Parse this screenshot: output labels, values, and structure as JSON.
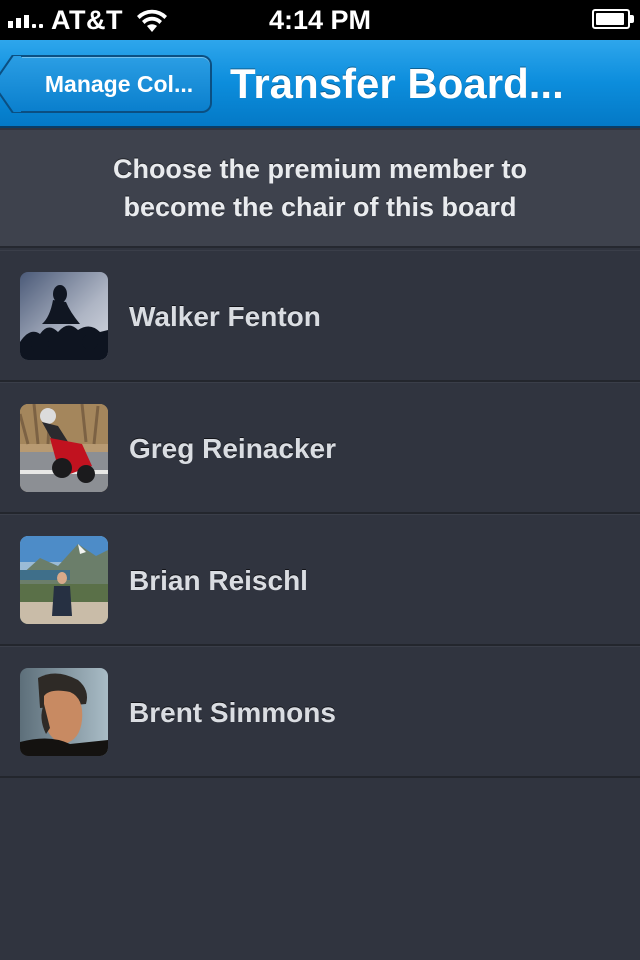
{
  "status_bar": {
    "carrier": "AT&T",
    "time": "4:14 PM",
    "signal_icon": "signal-bars-icon",
    "wifi_icon": "wifi-icon",
    "battery_icon": "battery-icon"
  },
  "nav": {
    "back_label": "Manage Col...",
    "title": "Transfer Board..."
  },
  "prompt": {
    "text": "Choose the premium member to become the chair of this board"
  },
  "members": [
    {
      "name": "Walker Fenton",
      "avatar": "avatar-silhouette"
    },
    {
      "name": "Greg Reinacker",
      "avatar": "avatar-motorcycle"
    },
    {
      "name": "Brian Reischl",
      "avatar": "avatar-mountain"
    },
    {
      "name": "Brent Simmons",
      "avatar": "avatar-portrait"
    }
  ],
  "colors": {
    "nav_blue": "#0c8ddc",
    "background": "#30343f",
    "prompt_bg": "#3e424d",
    "text": "#dadde2"
  }
}
